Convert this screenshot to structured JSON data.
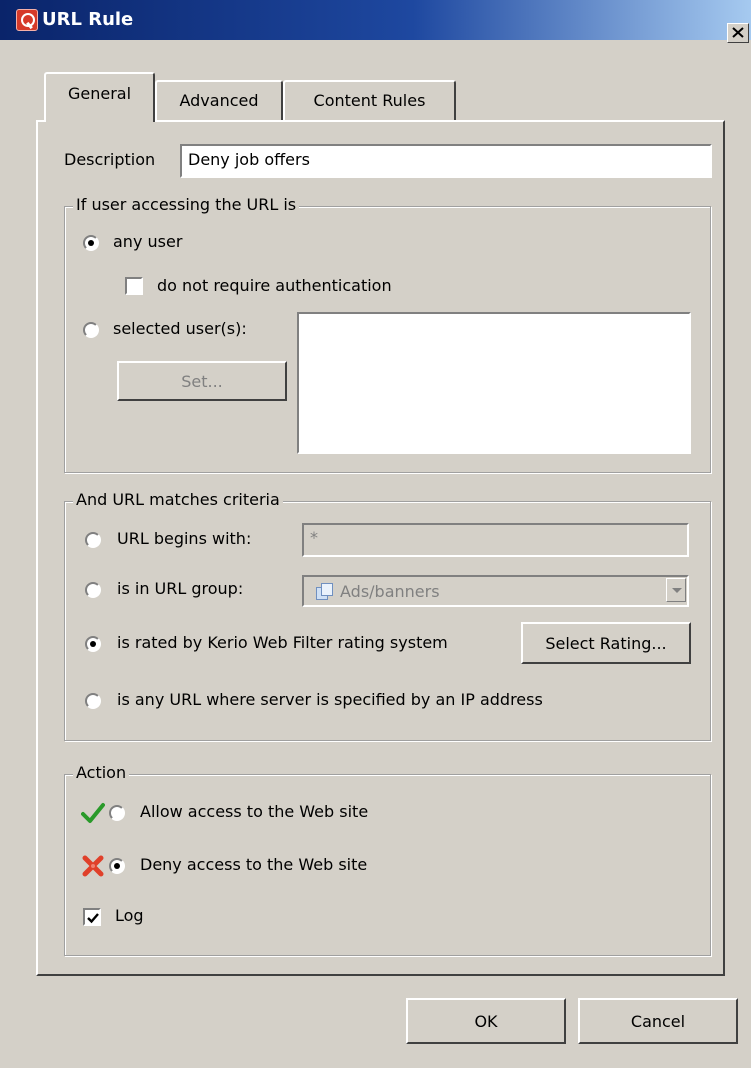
{
  "window": {
    "title": "URL Rule",
    "close_label": "close"
  },
  "tabs": [
    {
      "label": "General",
      "active": true
    },
    {
      "label": "Advanced",
      "active": false
    },
    {
      "label": "Content Rules",
      "active": false
    }
  ],
  "general": {
    "description_label": "Description",
    "description_value": "Deny job offers"
  },
  "users_group": {
    "title": "If user accessing the URL is",
    "any_user_label": "any user",
    "any_user_selected": true,
    "no_auth_label": "do not require authentication",
    "no_auth_checked": false,
    "selected_users_label": "selected user(s):",
    "selected_users_selected": false,
    "set_button_label": "Set..."
  },
  "criteria_group": {
    "title": "And URL matches criteria",
    "url_begins_label": "URL begins with:",
    "url_begins_value": "*",
    "url_group_label": "is in URL group:",
    "url_group_value": "Ads/banners",
    "rated_label": "is rated by Kerio Web Filter rating system",
    "rated_selected": true,
    "select_rating_label": "Select Rating...",
    "ip_label": "is any URL where server is specified by an IP address"
  },
  "action_group": {
    "title": "Action",
    "allow_label": "Allow access to the Web site",
    "allow_selected": false,
    "deny_label": "Deny access to the Web site",
    "deny_selected": true,
    "log_label": "Log",
    "log_checked": true,
    "colors": {
      "allow_icon": "#2a9a2a",
      "deny_icon": "#e0402a"
    }
  },
  "footer": {
    "ok_label": "OK",
    "cancel_label": "Cancel"
  }
}
